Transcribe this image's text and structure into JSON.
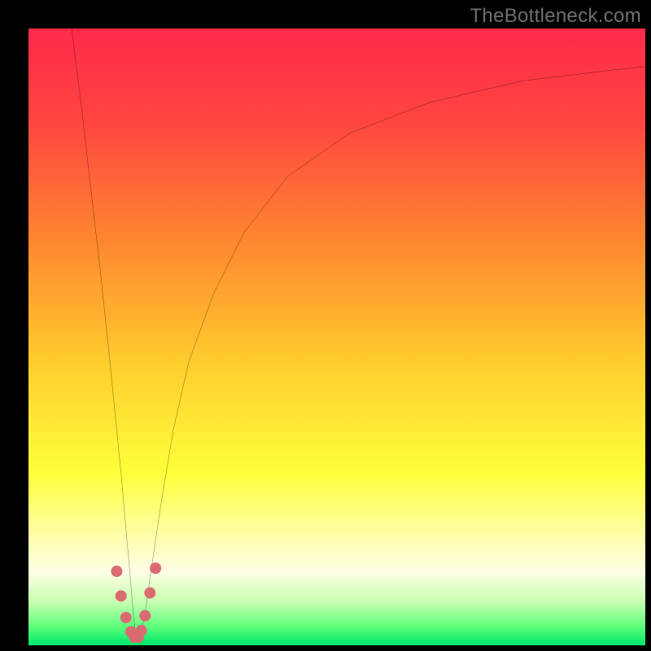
{
  "watermark": "TheBottleneck.com",
  "chart_data": {
    "type": "line",
    "title": "",
    "xlabel": "",
    "ylabel": "",
    "xlim": [
      0,
      100
    ],
    "ylim": [
      0,
      100
    ],
    "grid": false,
    "legend": false,
    "gradient_stops": [
      {
        "offset": 0.0,
        "color": "#ff2a4a"
      },
      {
        "offset": 0.15,
        "color": "#ff4540"
      },
      {
        "offset": 0.35,
        "color": "#ff892f"
      },
      {
        "offset": 0.55,
        "color": "#ffcf2e"
      },
      {
        "offset": 0.72,
        "color": "#ffff3a"
      },
      {
        "offset": 0.82,
        "color": "#feffa6"
      },
      {
        "offset": 0.88,
        "color": "#ffffe6"
      },
      {
        "offset": 0.93,
        "color": "#c7ffb0"
      },
      {
        "offset": 0.97,
        "color": "#5cff7a"
      },
      {
        "offset": 1.0,
        "color": "#00e66a"
      }
    ],
    "series": [
      {
        "name": "left-branch",
        "stroke": "#000000",
        "width": 2,
        "x": [
          7.0,
          8.5,
          10.0,
          11.5,
          13.0,
          14.0,
          15.0,
          15.8,
          16.5,
          17.0,
          17.4
        ],
        "y": [
          100,
          88,
          75,
          62,
          48,
          38,
          28,
          19,
          11,
          5,
          1.5
        ]
      },
      {
        "name": "right-branch",
        "stroke": "#000000",
        "width": 2,
        "x": [
          18.2,
          19.0,
          20.0,
          21.5,
          23.5,
          26.0,
          30.0,
          35.0,
          42.0,
          52.0,
          65.0,
          80.0,
          95.0,
          100.0
        ],
        "y": [
          1.5,
          6,
          13,
          23,
          35,
          46,
          57,
          67,
          76,
          83,
          88,
          91.5,
          93.3,
          93.8
        ]
      },
      {
        "name": "marker-dots",
        "stroke": "#db6b73",
        "type": "scatter",
        "radius": 7,
        "x": [
          14.3,
          15.0,
          15.8,
          16.6,
          17.2,
          17.8,
          18.3,
          18.9,
          19.7,
          20.6
        ],
        "y": [
          12.0,
          8.0,
          4.5,
          2.2,
          1.3,
          1.3,
          2.4,
          4.8,
          8.5,
          12.5
        ]
      }
    ]
  }
}
